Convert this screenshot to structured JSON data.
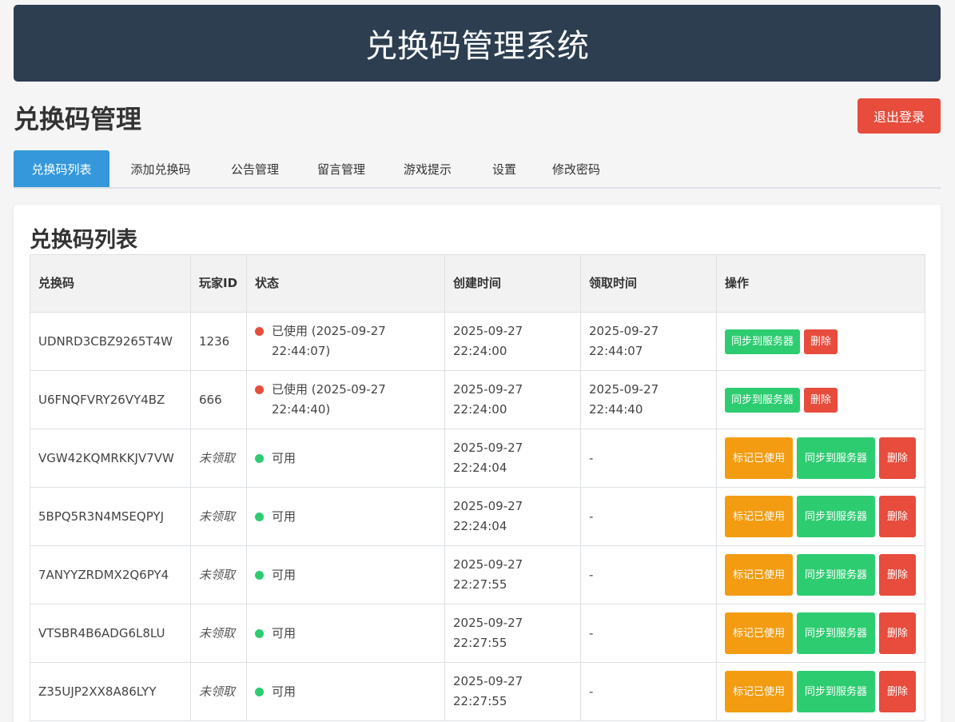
{
  "app": {
    "title": "兑换码管理系统"
  },
  "page": {
    "title": "兑换码管理",
    "logout_label": "退出登录"
  },
  "tabs": [
    {
      "label": "兑换码列表",
      "active": true
    },
    {
      "label": "添加兑换码",
      "active": false
    },
    {
      "label": "公告管理",
      "active": false
    },
    {
      "label": "留言管理",
      "active": false
    },
    {
      "label": "游戏提示",
      "active": false
    },
    {
      "label": "设置",
      "active": false
    },
    {
      "label": "修改密码",
      "active": false
    }
  ],
  "list": {
    "title": "兑换码列表",
    "columns": [
      "兑换码",
      "玩家ID",
      "状态",
      "创建时间",
      "领取时间",
      "操作"
    ],
    "rows": [
      {
        "code": "UDNRD3CBZ9265T4W",
        "player_id": "1236",
        "status": "已使用 (2025-09-27 22:44:07)",
        "status_type": "used",
        "created": "2025-09-27 22:24:00",
        "claimed": "2025-09-27 22:44:07"
      },
      {
        "code": "U6FNQFVRY26VY4BZ",
        "player_id": "666",
        "status": "已使用 (2025-09-27 22:44:40)",
        "status_type": "used",
        "created": "2025-09-27 22:24:00",
        "claimed": "2025-09-27 22:44:40"
      },
      {
        "code": "VGW42KQMRKKJV7VW",
        "player_id": "未领取",
        "status": "可用",
        "status_type": "available",
        "created": "2025-09-27 22:24:04",
        "claimed": "-"
      },
      {
        "code": "5BPQ5R3N4MSEQPYJ",
        "player_id": "未领取",
        "status": "可用",
        "status_type": "available",
        "created": "2025-09-27 22:24:04",
        "claimed": "-"
      },
      {
        "code": "7ANYYZRDMX2Q6PY4",
        "player_id": "未领取",
        "status": "可用",
        "status_type": "available",
        "created": "2025-09-27 22:27:55",
        "claimed": "-"
      },
      {
        "code": "VTSBR4B6ADG6L8LU",
        "player_id": "未领取",
        "status": "可用",
        "status_type": "available",
        "created": "2025-09-27 22:27:55",
        "claimed": "-"
      },
      {
        "code": "Z35UJP2XX8A86LYY",
        "player_id": "未领取",
        "status": "可用",
        "status_type": "available",
        "created": "2025-09-27 22:27:55",
        "claimed": "-"
      }
    ],
    "actions": {
      "mark_used": "标记已使用",
      "sync": "同步到服务器",
      "delete": "删除"
    }
  },
  "colors": {
    "banner": "#2c3e50",
    "tab_active": "#3498db",
    "danger": "#e74c3c",
    "success": "#2ecc71",
    "warning": "#f39c12"
  }
}
